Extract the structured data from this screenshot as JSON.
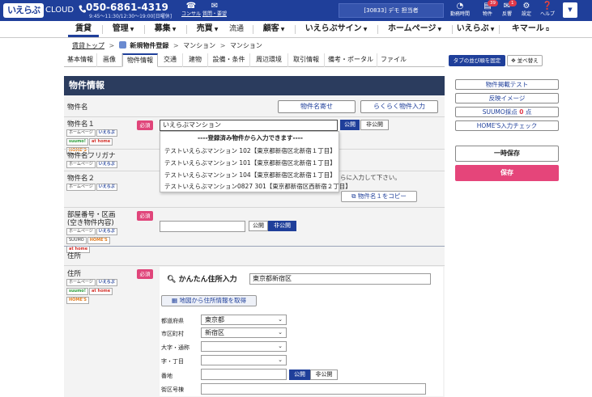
{
  "header": {
    "logo_text": "いえらぶ",
    "logo_cloud": "CLOUD",
    "phone": "050-6861-4319",
    "hours": "9:45〜11:30/12:30〜19:00[日曜休]",
    "concierge_label": "コンサル",
    "request_label": "質問・要望",
    "user_label": "[30833] デモ 担当者",
    "icons": [
      {
        "name": "clock-icon",
        "label": "勤務時間"
      },
      {
        "name": "property-icon",
        "label": "物件",
        "badge": "39"
      },
      {
        "name": "feedback-icon",
        "label": "反響",
        "badge": "1"
      },
      {
        "name": "settings-icon",
        "label": "設定"
      },
      {
        "name": "help-icon",
        "label": "ヘルプ"
      }
    ]
  },
  "main_nav": [
    {
      "label": "賃貸",
      "active": true
    },
    {
      "label": "管理"
    },
    {
      "label": "募集"
    },
    {
      "label": "売買"
    },
    {
      "label": "流通"
    },
    {
      "label": "顧客"
    },
    {
      "label": "いえらぶサイン"
    },
    {
      "label": "ホームページ"
    },
    {
      "label": "いえらぶ"
    },
    {
      "label": "キマール"
    }
  ],
  "breadcrumb": {
    "top": "賃貸トップ",
    "current": "新規物件登録",
    "b2": "マンション",
    "b3": "マンション"
  },
  "sub_tabs": [
    "基本情報",
    "画像",
    "物件情報",
    "交通",
    "建物",
    "設備・条件",
    "周辺環境",
    "取引情報",
    "備考・ポータル",
    "ファイル"
  ],
  "sub_tabs_active": "物件情報",
  "tab_order_btn": "タブの並び順を固定",
  "sort_btn": "並べ替え",
  "panel": {
    "title": "物件情報",
    "section1": "物件名",
    "btn_name_copy": "物件名寄せ",
    "btn_easy_input": "らくらく物件入力",
    "required": "必須",
    "public": "公開",
    "private": "非公開",
    "name1_label": "物件名１",
    "name1_value": "いえらぶマンション",
    "furigana_label": "物件名フリガナ",
    "name2_label": "物件名２",
    "name2_hint": "らに入力して下さい。",
    "copy_btn": "物件名１をコピー",
    "room_label1": "部屋番号・区画",
    "room_label2": "(空き物件内容)",
    "section2": "住所",
    "address_label": "住所",
    "easy_address_label": "かんたん住所入力",
    "easy_address_value": "東京都新宿区",
    "map_btn": "地図から住所情報を取得",
    "fields": {
      "pref_label": "都道府県",
      "pref_value": "東京都",
      "city_label": "市区町村",
      "city_value": "新宿区",
      "oaza_label": "大字・通称",
      "chome_label": "字・丁目",
      "banchi_label": "番地",
      "gaiku_label": "街区号棟"
    }
  },
  "portal_tags": {
    "homepage": "ホームページ",
    "ieraboo": "いえらぶ\nポータル",
    "suumo": "suumo!",
    "athome": "at home",
    "homes": "HOME'S"
  },
  "dropdown": {
    "heading": "----登録済み物件から入力できます----",
    "items": [
      "テストいえらぶマンション 102【東京都新宿区北新宿１丁目】",
      "テストいえらぶマンション 101【東京都新宿区北新宿１丁目】",
      "テストいえらぶマンション 104【東京都新宿区北新宿１丁目】",
      "テストいえらぶマンション0827 301【東京都新宿区西新宿２丁目】"
    ]
  },
  "sidebar": {
    "btn1": "物件掲載テスト",
    "btn2": "反映イメージ",
    "btn3_prefix": "SUUMO採点",
    "btn3_score": "0",
    "btn3_suffix": "点",
    "btn4": "HOME'S入力チェック",
    "temp_save": "一時保存",
    "save": "保存"
  },
  "colors": {
    "brand": "#1f3f9a",
    "panel_head": "#2b3c5e",
    "required": "#e0457a",
    "save": "#e5457a"
  }
}
